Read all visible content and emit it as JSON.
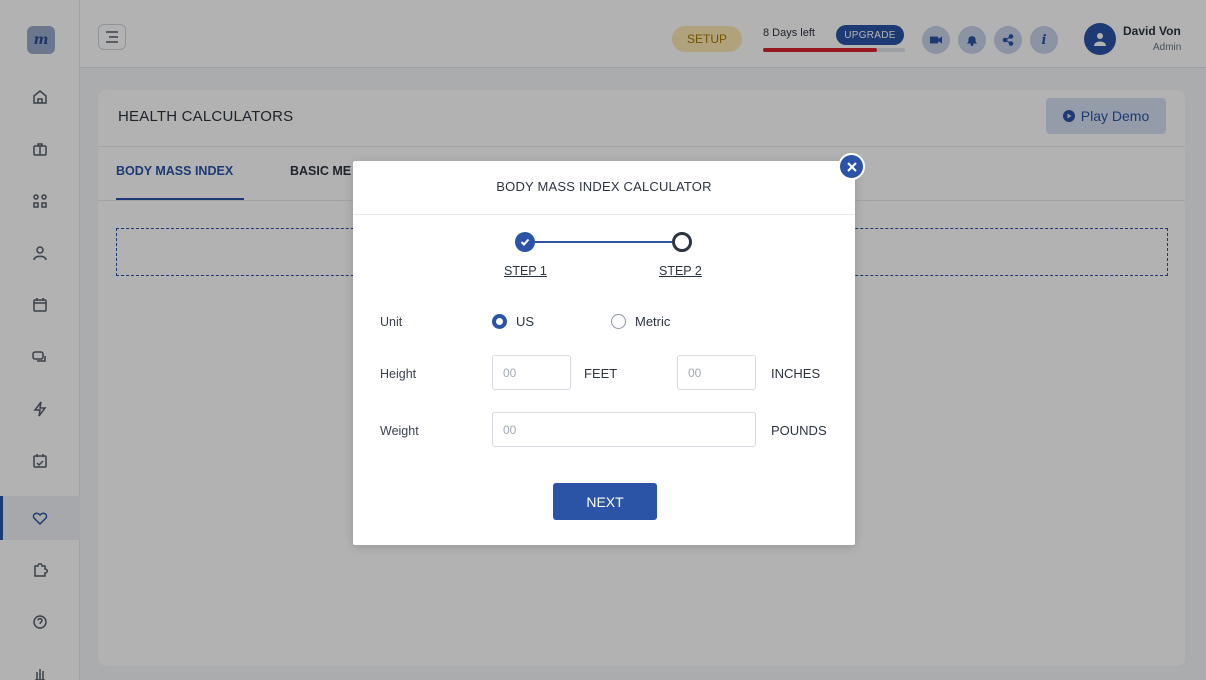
{
  "app": {
    "logo_text": "m"
  },
  "sidebar": {
    "items": [
      {
        "icon": "home-icon"
      },
      {
        "icon": "briefcase-icon"
      },
      {
        "icon": "apps-icon"
      },
      {
        "icon": "user-icon"
      },
      {
        "icon": "calendar-icon"
      },
      {
        "icon": "chat-icon"
      },
      {
        "icon": "lightning-icon"
      },
      {
        "icon": "calendar-check-icon"
      },
      {
        "icon": "heart-icon",
        "active": true
      },
      {
        "icon": "puzzle-icon"
      },
      {
        "icon": "help-icon"
      },
      {
        "icon": "hand-icon"
      }
    ]
  },
  "topbar": {
    "setup_label": "SETUP",
    "days_left": "8 Days left",
    "upgrade_label": "UPGRADE",
    "trial_progress": 0.8,
    "icons": [
      "video-icon",
      "bell-icon",
      "share-icon",
      "info-icon"
    ],
    "info_text": "i",
    "user_name": "David Von",
    "user_role": "Admin"
  },
  "page": {
    "title": "HEALTH CALCULATORS",
    "demo_label": "Play Demo",
    "tabs": [
      {
        "label": "BODY MASS INDEX",
        "active": true
      },
      {
        "label": "BASIC ME"
      }
    ]
  },
  "modal": {
    "title": "BODY MASS INDEX CALCULATOR",
    "steps": [
      {
        "label": "STEP 1",
        "complete": true
      },
      {
        "label": "STEP 2",
        "complete": false
      }
    ],
    "unit_label": "Unit",
    "unit_options": [
      {
        "label": "US",
        "selected": true
      },
      {
        "label": "Metric",
        "selected": false
      }
    ],
    "height_label": "Height",
    "height_feet_placeholder": "00",
    "feet_unit": "FEET",
    "height_inches_placeholder": "00",
    "inches_unit": "INCHES",
    "weight_label": "Weight",
    "weight_placeholder": "00",
    "pounds_unit": "POUNDS",
    "next_label": "NEXT"
  },
  "colors": {
    "accent": "#2b54a6",
    "setup_bg": "#fde9b2",
    "trial_bar": "#d9232e"
  }
}
